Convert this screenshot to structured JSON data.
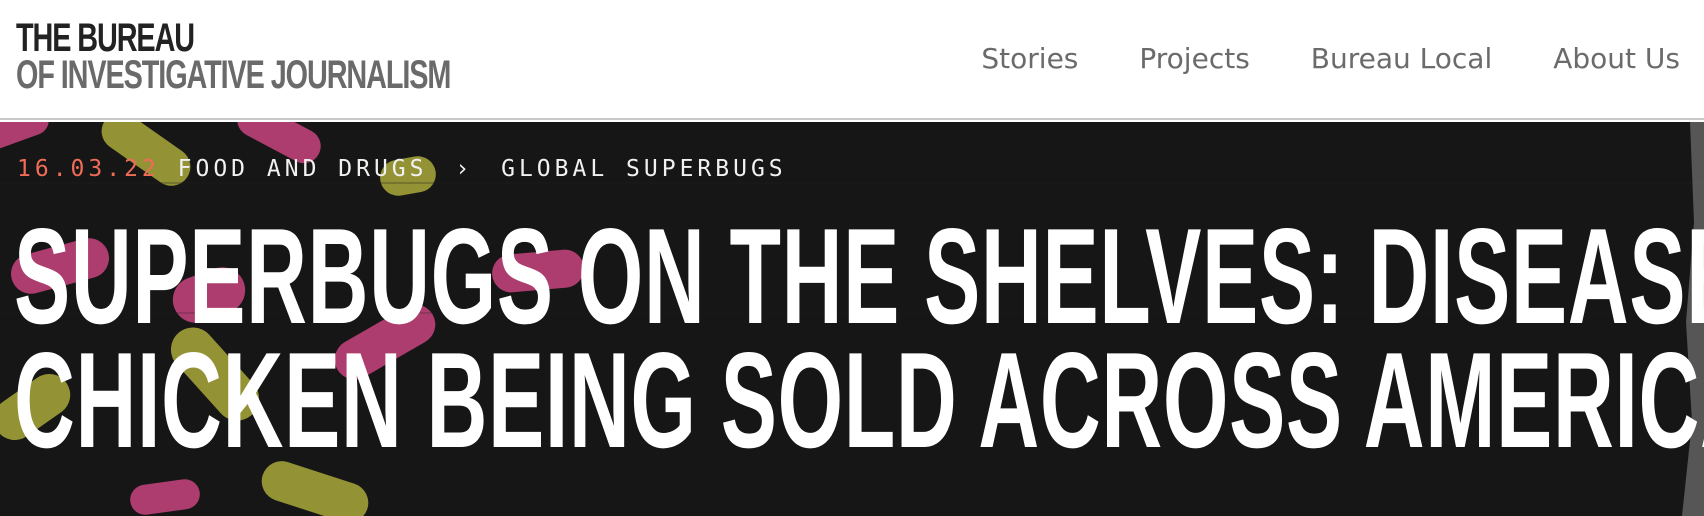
{
  "logo": {
    "line1": "THE BUREAU",
    "line2": "OF INVESTIGATIVE JOURNALISM"
  },
  "nav": {
    "items": [
      {
        "label": "Stories"
      },
      {
        "label": "Projects"
      },
      {
        "label": "Bureau Local"
      },
      {
        "label": "About Us"
      }
    ]
  },
  "article": {
    "date": "16.03.22",
    "category": "FOOD AND DRUGS",
    "separator": "›",
    "subcategory": "GLOBAL SUPERBUGS",
    "headline_line1": "SUPERBUGS ON THE SHELVES: DISEASED",
    "headline_line2": "CHICKEN BEING SOLD ACROSS AMERICA"
  },
  "colors": {
    "date_accent": "#f06c57",
    "hero_background": "#161616",
    "pill_pink": "#c9447f",
    "pill_yellow": "#a9a83a"
  }
}
